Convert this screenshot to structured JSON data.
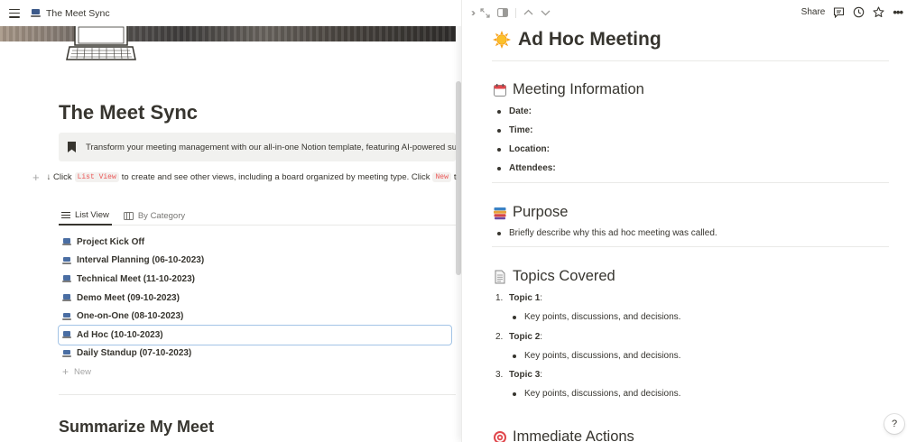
{
  "topbar": {
    "title": "The Meet Sync"
  },
  "left": {
    "title": "The Meet Sync",
    "callout": "Transform your meeting management with our all-in-one Notion template, featuring AI-powered su",
    "hint": {
      "prefix": "↓ Click",
      "code1": "List View",
      "middle": "to create and see other views, including a board organized by meeting type. Click",
      "code2": "New",
      "suffix": "to"
    },
    "tabs": [
      "List View",
      "By Category"
    ],
    "items": [
      "Project Kick Off",
      "Interval Planning (06-10-2023)",
      "Technical Meet (11-10-2023)",
      "Demo Meet (09-10-2023)",
      "One-on-One (08-10-2023)",
      "Ad Hoc (10-10-2023)",
      "Daily Standup (07-10-2023)"
    ],
    "new_label": "New",
    "section_heading": "Summarize My Meet"
  },
  "right": {
    "share": "Share",
    "title": "Ad Hoc Meeting",
    "info": {
      "heading": "Meeting Information",
      "fields": [
        "Date:",
        "Time:",
        "Location:",
        "Attendees:"
      ]
    },
    "purpose": {
      "heading": "Purpose",
      "text": "Briefly describe why this ad hoc meeting was called."
    },
    "topics": {
      "heading": "Topics Covered",
      "items": [
        {
          "n": "1.",
          "label": "Topic 1",
          "colon": ":",
          "detail": "Key points, discussions, and decisions."
        },
        {
          "n": "2.",
          "label": "Topic 2",
          "colon": ":",
          "detail": "Key points, discussions, and decisions."
        },
        {
          "n": "3.",
          "label": "Topic 3",
          "colon": ":",
          "detail": "Key points, discussions, and decisions."
        }
      ]
    },
    "actions": {
      "heading": "Immediate Actions"
    },
    "help": "?"
  },
  "colors": {
    "accent_blue": "#a3c4e6",
    "code_red": "#eb5757",
    "text": "#37352f"
  }
}
